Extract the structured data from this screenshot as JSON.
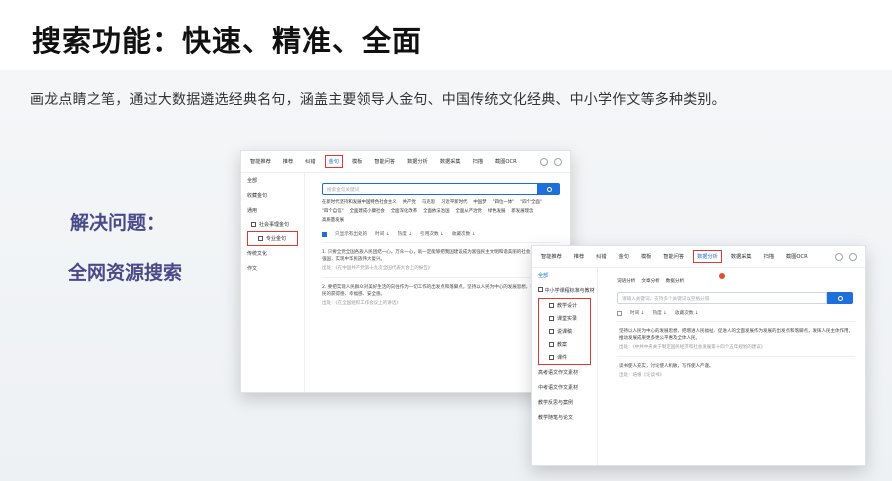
{
  "heading": {
    "title": "搜索功能：快速、精准、全面",
    "subtitle": "画龙点睛之笔，通过大数据遴选经典名句，涵盖主要领导人金句、中国传统文化经典、中小学作文等多种类别。"
  },
  "labels": {
    "problem": "解决问题：",
    "solution": "全网资源搜索"
  },
  "window1": {
    "tabs": [
      "智能推荐",
      "推荐",
      "纠错",
      "金句",
      "模板",
      "智能问答",
      "数据分析",
      "数据采集",
      "扫描",
      "截图OCR"
    ],
    "active_tab": "金句",
    "sidebar": {
      "items": [
        "全部",
        "收藏金句",
        "通用"
      ],
      "subitems": [
        "社会事理金句",
        "专业金句"
      ],
      "tail_items": [
        "传统文化",
        "作文"
      ]
    },
    "search_placeholder": "搜索金句关键词",
    "chips": [
      "在新时代坚持和发展中国特色社会主义",
      "共产党",
      "马克思",
      "习近平新时代",
      "中国梦",
      "\"四位一体\"",
      "\"四个全面\"",
      "\"四个自信\"",
      "全面建成小康社会",
      "全面深化改革",
      "全面依法治国",
      "全面从严治党",
      "绿色发展",
      "新发展理念",
      "高质量发展"
    ],
    "filter": {
      "checkbox_label": "只显示有出处的",
      "options": [
        "时间 ↓",
        "热度 ↓",
        "引用次数 ↓",
        "收藏次数 ↓"
      ]
    },
    "results": [
      {
        "text": "1. 只要全党全国各族人民团结一心，万众一心，就一定能够把我国建设成为富强民主文明和谐美丽的社会主义现代化强国，实现中华民族伟大复兴。",
        "meta": "出处：《在中国共产党第十九次全国代表大会上的报告》"
      },
      {
        "text": "2. 要把实现人民群众对美好生活的向往作为一切工作的出发点和落脚点，坚持以人民为中心的发展思想，不断增强人民的获得感、幸福感、安全感。",
        "meta": "出处：《在全国组织工作会议上的讲话》"
      }
    ]
  },
  "window2": {
    "tabs": [
      "智能推荐",
      "推荐",
      "纠错",
      "金句",
      "模板",
      "智能问答",
      "数据分析",
      "数据采集",
      "扫描",
      "截图OCR"
    ],
    "active_tab": "数据分析",
    "sidebar": {
      "header": "全部",
      "group": "中小学课程标准与教材",
      "subitems": [
        "教学设计",
        "课堂实录",
        "说课稿",
        "教案",
        "课件"
      ],
      "tail_items": [
        "高考语文作文素材",
        "中考语文作文素材",
        "教学反思与案例",
        "教学随笔与论文"
      ]
    },
    "subtabs": [
      "词语分析",
      "文章分析",
      "数据分析"
    ],
    "search_placeholder": "请输入关键词，支持多个关键词以空格分隔",
    "filter": {
      "options": [
        "时间 ↓",
        "热度 ↓",
        "收藏次数 ↓"
      ]
    },
    "results": [
      {
        "text": "坚持以人民为中心的发展思想，把增进人民福祉、促进人的全面发展作为发展的出发点和落脚点，发挥人民主体作用，推动发展成果更多更公平惠及全体人民。",
        "meta": "出处：《中共中央关于制定国民经济和社会发展第十四个五年规划的建议》"
      },
      {
        "text": "读书使人充实，讨论使人机敏，写作使人严谨。",
        "meta": "出处：培根《论读书》"
      }
    ]
  }
}
